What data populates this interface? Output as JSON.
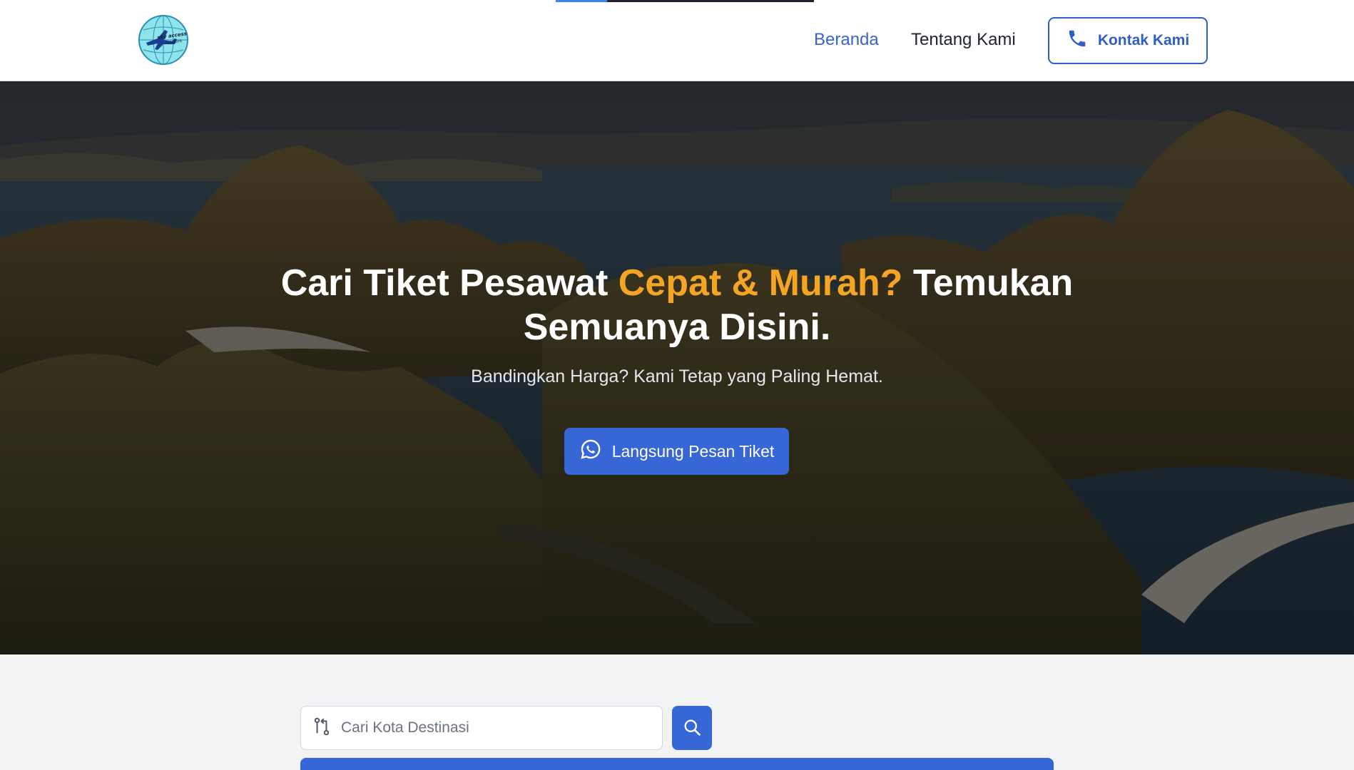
{
  "header": {
    "logo_text": "sky access network",
    "nav": [
      {
        "label": "Beranda",
        "active": true
      },
      {
        "label": "Tentang Kami",
        "active": false
      }
    ],
    "contact_label": "Kontak Kami",
    "page_load_progress": 0.2
  },
  "hero": {
    "title_part1": "Cari Tiket Pesawat ",
    "title_accent": "Cepat & Murah?",
    "title_part2": " Temukan Semuanya Disini.",
    "subtitle": "Bandingkan Harga? Kami Tetap yang Paling Hemat.",
    "cta_label": "Langsung Pesan Tiket"
  },
  "search": {
    "placeholder": "Cari Kota Destinasi",
    "value": ""
  },
  "icons": {
    "contact": "phone-icon",
    "cta": "whatsapp-icon",
    "search_field": "route-icon",
    "search_button": "search-icon"
  },
  "colors": {
    "primary": "#3766d6",
    "accent": "#f5a524",
    "nav_active": "#3a64c8"
  }
}
